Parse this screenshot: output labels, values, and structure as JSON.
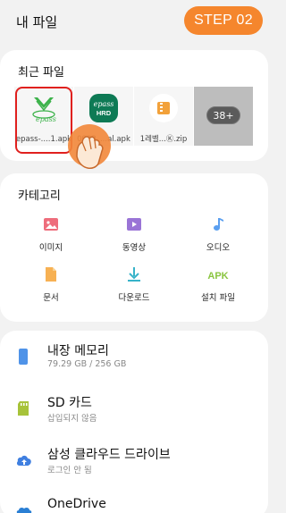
{
  "header": {
    "title": "내 파일",
    "step_badge": "STEP 02"
  },
  "recent": {
    "title": "최근 파일",
    "files": [
      {
        "name": "epass-....1.apk",
        "icon": "epass-logo-icon"
      },
      {
        "name": "0903_...al.apk",
        "icon": "epass-hrd-app-icon"
      },
      {
        "name": "1레벨...Ⓚ.zip",
        "icon": "zip-file-icon"
      }
    ],
    "more_count": "38+"
  },
  "category": {
    "title": "카테고리",
    "items": [
      {
        "label": "이미지",
        "icon": "image-icon"
      },
      {
        "label": "동영상",
        "icon": "video-icon"
      },
      {
        "label": "오디오",
        "icon": "audio-icon"
      },
      {
        "label": "문서",
        "icon": "document-icon"
      },
      {
        "label": "다운로드",
        "icon": "download-icon"
      },
      {
        "label": "설치 파일",
        "icon": "apk-icon",
        "icon_text": "APK"
      }
    ]
  },
  "storage": [
    {
      "title": "내장 메모리",
      "sub": "79.29 GB / 256 GB",
      "icon": "phone-icon"
    },
    {
      "title": "SD 카드",
      "sub": "삽입되지 않음",
      "icon": "sd-card-icon"
    },
    {
      "title": "삼성 클라우드 드라이브",
      "sub": "로그인 안 됨",
      "icon": "cloud-upload-icon"
    },
    {
      "title": "OneDrive",
      "sub": "",
      "icon": "onedrive-icon"
    }
  ],
  "colors": {
    "accent_orange": "#f5862d",
    "highlight_red": "#e0201e",
    "image_pink": "#ee6d7c",
    "video_purple": "#9a74d6",
    "audio_blue": "#5a9ff0",
    "doc_orange": "#f7b153",
    "download_teal": "#37b3c9",
    "apk_green": "#8ac540"
  }
}
